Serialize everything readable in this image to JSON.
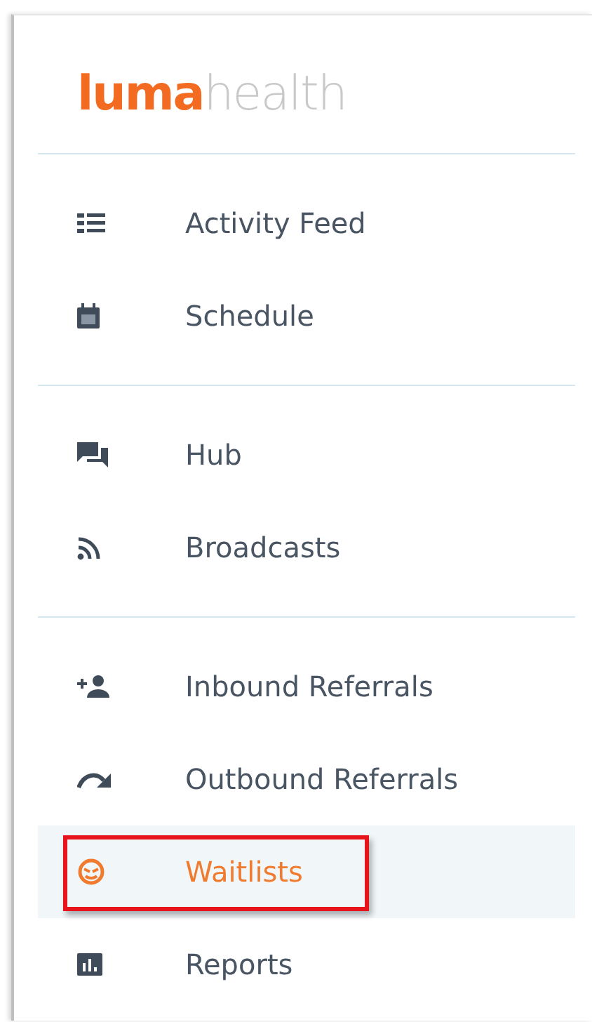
{
  "logo": {
    "primary": "luma",
    "secondary": "health"
  },
  "sections": [
    {
      "items": [
        {
          "label": "Activity Feed",
          "selected": false,
          "highlighted": false
        },
        {
          "label": "Schedule",
          "selected": false,
          "highlighted": false
        }
      ]
    },
    {
      "items": [
        {
          "label": "Hub",
          "selected": false,
          "highlighted": false
        },
        {
          "label": "Broadcasts",
          "selected": false,
          "highlighted": false
        }
      ]
    },
    {
      "items": [
        {
          "label": "Inbound Referrals",
          "selected": false,
          "highlighted": false
        },
        {
          "label": "Outbound Referrals",
          "selected": false,
          "highlighted": false
        },
        {
          "label": "Waitlists",
          "selected": true,
          "highlighted": true
        },
        {
          "label": "Reports",
          "selected": false,
          "highlighted": false
        }
      ]
    }
  ]
}
